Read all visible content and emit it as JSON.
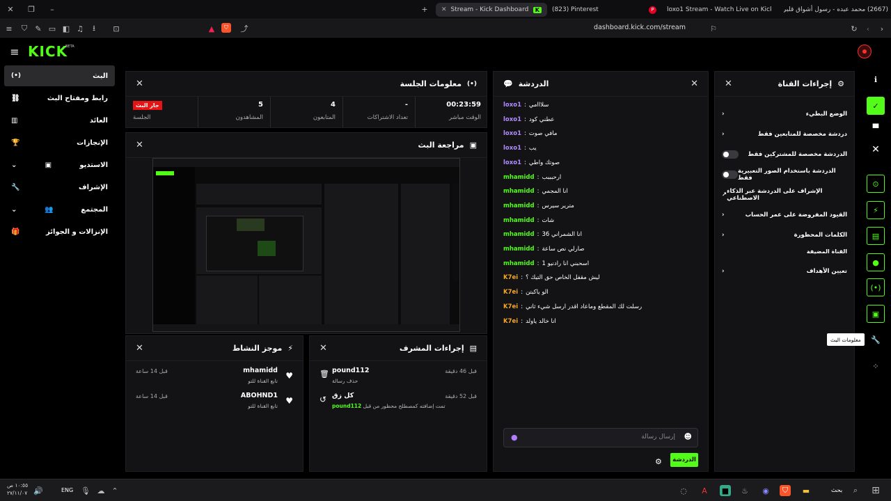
{
  "browser": {
    "tabs": [
      {
        "label": "Stream - Kick Dashboard",
        "active": true
      },
      {
        "label": "(823) Pinterest",
        "active": false
      },
      {
        "label": "loxo1 Stream - Watch Live on Kick",
        "active": false
      },
      {
        "label": "(2667) محمد عبده - رسول أشواق قلبي",
        "active": false
      }
    ],
    "url": "dashboard.kick.com/stream"
  },
  "app": {
    "logo": "KICK",
    "beta": "BETA",
    "accent": "#53fc18"
  },
  "sidebar": {
    "items": [
      {
        "label": "البث",
        "active": true
      },
      {
        "label": "رابط ومفتاح البث"
      },
      {
        "label": "العائد"
      },
      {
        "label": "الإنجازات"
      },
      {
        "label": "الاستديو"
      },
      {
        "label": "الإشراف"
      },
      {
        "label": "المجتمع"
      },
      {
        "label": "الإنزالات و الجوائز"
      }
    ]
  },
  "session": {
    "title": "معلومات الجلسة",
    "live_badge": "جار البث",
    "session_label": "الجلسة",
    "stats": [
      {
        "value": "00:23:59",
        "label": "الوقت مباشر"
      },
      {
        "value": "-",
        "label": "تعداد الاشتراكات"
      },
      {
        "value": "4",
        "label": "المتابعون"
      },
      {
        "value": "5",
        "label": "المشاهدون"
      }
    ]
  },
  "preview": {
    "title": "مراجعة البث"
  },
  "activity": {
    "title": "موجز النشاط",
    "items": [
      {
        "user": "mhamidd",
        "desc": "تابع القناة للتو",
        "time": "قبل 14 ساعة"
      },
      {
        "user": "ABOHND1",
        "desc": "تابع القناة للتو",
        "time": "قبل 14 ساعة"
      }
    ]
  },
  "modactions": {
    "title": "إجراءات المشرف",
    "items": [
      {
        "user": "pound112",
        "desc": "حذف رسالة",
        "time": "قبل 46 دقيقة"
      },
      {
        "user": "كل زق",
        "desc_user": "pound112",
        "desc": "تمت إضافته كمصطلح محظور من قبل",
        "time": "قبل 52 دقيقة"
      }
    ]
  },
  "chat": {
    "title": "الدردشة",
    "messages": [
      {
        "user": "loxo1",
        "color": "#b28cff",
        "text": "سلااامي"
      },
      {
        "user": "loxo1",
        "color": "#b28cff",
        "text": "عطني كود"
      },
      {
        "user": "loxo1",
        "color": "#b28cff",
        "text": "مافي صوت"
      },
      {
        "user": "loxo1",
        "color": "#b28cff",
        "text": "يب"
      },
      {
        "user": "loxo1",
        "color": "#b28cff",
        "text": "صوتك واطي"
      },
      {
        "user": "mhamidd",
        "color": "#53fc18",
        "text": "ارحبببب"
      },
      {
        "user": "mhamidd",
        "color": "#53fc18",
        "text": "انا المجمي"
      },
      {
        "user": "mhamidd",
        "color": "#53fc18",
        "text": "مترير سيرس"
      },
      {
        "user": "mhamidd",
        "color": "#53fc18",
        "text": "شات"
      },
      {
        "user": "mhamidd",
        "color": "#53fc18",
        "text": "انا الشمراني 36"
      },
      {
        "user": "mhamidd",
        "color": "#53fc18",
        "text": "صارلي نص ساعة"
      },
      {
        "user": "mhamidd",
        "color": "#53fc18",
        "text": "اسحبني انا رادنيو 1"
      },
      {
        "user": "K7ei",
        "color": "#f5a623",
        "text": "ليش مقفل الخاص حق التيك ؟"
      },
      {
        "user": "K7ei",
        "color": "#f5a623",
        "text": "الو ياكبتن"
      },
      {
        "user": "K7ei",
        "color": "#f5a623",
        "text": "رسلت لك المقطع وماعاد اقدر ارسل شيء ثاني"
      },
      {
        "user": "K7ei",
        "color": "#f5a623",
        "text": "انا خالد ياولد"
      }
    ],
    "placeholder": "إرسال رسالة",
    "send_label": "الدردشة"
  },
  "channel_actions": {
    "title": "إجراءات القناة",
    "items": [
      {
        "label": "الوضع البطيء",
        "kind": "chevron"
      },
      {
        "label": "دردشة مخصصة للمتابعين فقط",
        "kind": "chevron"
      },
      {
        "label": "الدردشة مخصصة للمشتركين فقط",
        "kind": "toggle"
      },
      {
        "label": "الدردشة باستخدام الصور التعبيرية فقط",
        "kind": "toggle"
      },
      {
        "label": "الإشراف على الدردشة عبر الذكاء الاصطناعي",
        "kind": "external"
      },
      {
        "label": "القيود المفروضة على عمر الحساب",
        "kind": "chevron"
      },
      {
        "label": "الكلمات المحظورة",
        "kind": "chevron"
      }
    ],
    "section": "القناة المضيفة",
    "host_item": "تعيين الأهداف"
  },
  "tooltip": "معلومات البث",
  "taskbar": {
    "time": "١٠:٥٥ ص",
    "date": "٢٧/١١/٠٧",
    "lang": "ENG",
    "search": "بحث"
  }
}
